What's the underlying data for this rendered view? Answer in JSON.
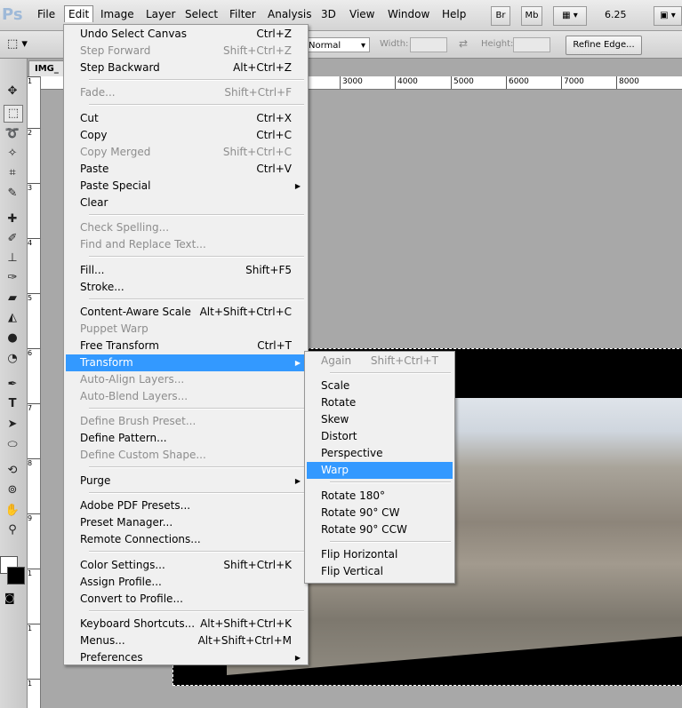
{
  "app": {
    "logo": "Ps"
  },
  "menubar": {
    "items": [
      "File",
      "Edit",
      "Image",
      "Layer",
      "Select",
      "Filter",
      "Analysis",
      "3D",
      "View",
      "Window",
      "Help"
    ],
    "bridge_label": "Br",
    "minibridge_label": "Mb",
    "zoom": "6.25"
  },
  "options": {
    "mode": "Normal",
    "width_label": "Width:",
    "height_label": "Height:",
    "refine_edge": "Refine Edge..."
  },
  "document": {
    "tab_label": "IMG_"
  },
  "ruler": {
    "top_ticks": [
      "3000",
      "4000",
      "5000",
      "6000",
      "7000",
      "8000"
    ],
    "left_ticks": [
      "1",
      "2",
      "3",
      "4",
      "5",
      "6",
      "7",
      "8",
      "9",
      "1",
      "1",
      "1"
    ]
  },
  "edit_menu": {
    "groups": [
      [
        {
          "label": "Undo Select Canvas",
          "shortcut": "Ctrl+Z"
        },
        {
          "label": "Step Forward",
          "shortcut": "Shift+Ctrl+Z",
          "disabled": true
        },
        {
          "label": "Step Backward",
          "shortcut": "Alt+Ctrl+Z"
        }
      ],
      [
        {
          "label": "Fade...",
          "shortcut": "Shift+Ctrl+F",
          "disabled": true
        }
      ],
      [
        {
          "label": "Cut",
          "shortcut": "Ctrl+X"
        },
        {
          "label": "Copy",
          "shortcut": "Ctrl+C"
        },
        {
          "label": "Copy Merged",
          "shortcut": "Shift+Ctrl+C",
          "disabled": true
        },
        {
          "label": "Paste",
          "shortcut": "Ctrl+V"
        },
        {
          "label": "Paste Special",
          "submenu": true
        },
        {
          "label": "Clear"
        }
      ],
      [
        {
          "label": "Check Spelling...",
          "disabled": true
        },
        {
          "label": "Find and Replace Text...",
          "disabled": true
        }
      ],
      [
        {
          "label": "Fill...",
          "shortcut": "Shift+F5"
        },
        {
          "label": "Stroke..."
        }
      ],
      [
        {
          "label": "Content-Aware Scale",
          "shortcut": "Alt+Shift+Ctrl+C"
        },
        {
          "label": "Puppet Warp",
          "disabled": true
        },
        {
          "label": "Free Transform",
          "shortcut": "Ctrl+T"
        },
        {
          "label": "Transform",
          "submenu": true,
          "highlighted": true
        },
        {
          "label": "Auto-Align Layers...",
          "disabled": true
        },
        {
          "label": "Auto-Blend Layers...",
          "disabled": true
        }
      ],
      [
        {
          "label": "Define Brush Preset...",
          "disabled": true
        },
        {
          "label": "Define Pattern..."
        },
        {
          "label": "Define Custom Shape...",
          "disabled": true
        }
      ],
      [
        {
          "label": "Purge",
          "submenu": true
        }
      ],
      [
        {
          "label": "Adobe PDF Presets..."
        },
        {
          "label": "Preset Manager..."
        },
        {
          "label": "Remote Connections..."
        }
      ],
      [
        {
          "label": "Color Settings...",
          "shortcut": "Shift+Ctrl+K"
        },
        {
          "label": "Assign Profile..."
        },
        {
          "label": "Convert to Profile..."
        }
      ],
      [
        {
          "label": "Keyboard Shortcuts...",
          "shortcut": "Alt+Shift+Ctrl+K"
        },
        {
          "label": "Menus...",
          "shortcut": "Alt+Shift+Ctrl+M"
        },
        {
          "label": "Preferences",
          "submenu": true
        }
      ]
    ]
  },
  "transform_menu": {
    "groups": [
      [
        {
          "label": "Again",
          "shortcut": "Shift+Ctrl+T",
          "disabled": true
        }
      ],
      [
        {
          "label": "Scale"
        },
        {
          "label": "Rotate"
        },
        {
          "label": "Skew"
        },
        {
          "label": "Distort"
        },
        {
          "label": "Perspective"
        },
        {
          "label": "Warp",
          "highlighted": true
        }
      ],
      [
        {
          "label": "Rotate 180°"
        },
        {
          "label": "Rotate 90° CW"
        },
        {
          "label": "Rotate 90° CCW"
        }
      ],
      [
        {
          "label": "Flip Horizontal"
        },
        {
          "label": "Flip Vertical"
        }
      ]
    ]
  },
  "tools": [
    "move-tool",
    "marquee-tool",
    "lasso-tool",
    "quick-select-tool",
    "crop-tool",
    "eyedropper-tool",
    "healing-tool",
    "brush-tool",
    "stamp-tool",
    "history-brush-tool",
    "eraser-tool",
    "paint-bucket-tool",
    "blur-tool",
    "dodge-tool",
    "pen-tool",
    "type-tool",
    "path-select-tool",
    "shape-tool",
    "3d-rotate-tool",
    "3d-orbit-tool",
    "hand-tool",
    "zoom-tool"
  ]
}
